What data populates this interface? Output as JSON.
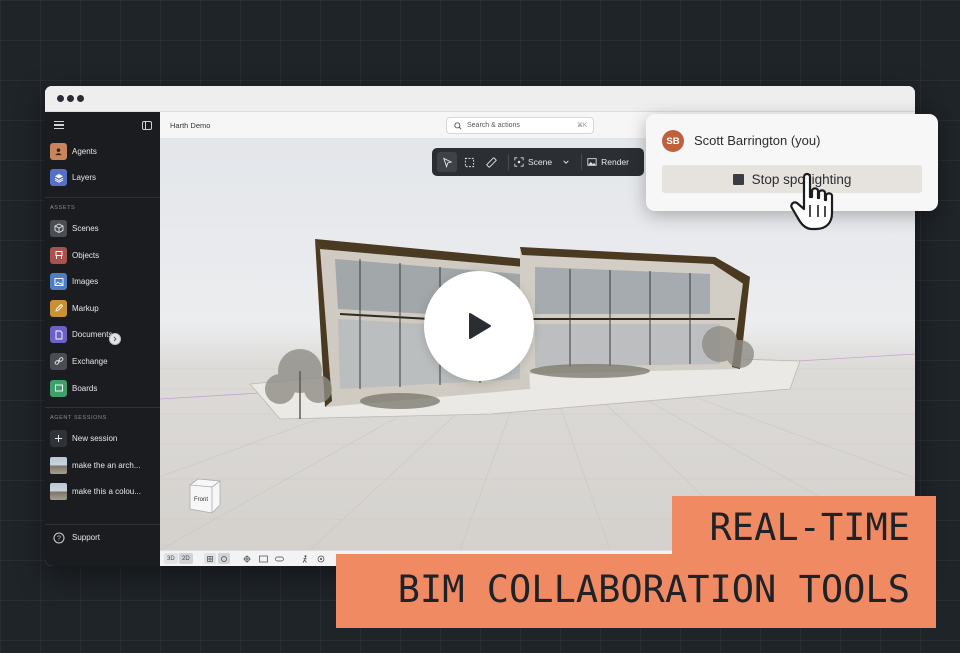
{
  "app": {
    "project_name": "Harth Demo",
    "search_placeholder": "Search & actions",
    "search_shortcut": "⌘K"
  },
  "sidebar": {
    "top_items": [
      {
        "label": "Agents",
        "icon": "agent-icon",
        "color": "#c9855a"
      },
      {
        "label": "Layers",
        "icon": "layers-icon",
        "color": "#5670c9"
      }
    ],
    "assets_heading": "ASSETS",
    "asset_items": [
      {
        "label": "Scenes",
        "icon": "cube-icon",
        "color": "#4a4d53"
      },
      {
        "label": "Objects",
        "icon": "chair-icon",
        "color": "#a8524c"
      },
      {
        "label": "Images",
        "icon": "image-icon",
        "color": "#4f7dc2"
      },
      {
        "label": "Markup",
        "icon": "pen-icon",
        "color": "#c99035"
      },
      {
        "label": "Documents",
        "icon": "document-icon",
        "color": "#6c61c4"
      },
      {
        "label": "Exchange",
        "icon": "link-icon",
        "color": "#4a4d53"
      },
      {
        "label": "Boards",
        "icon": "board-icon",
        "color": "#3f9e6a"
      }
    ],
    "sessions_heading": "AGENT SESSIONS",
    "session_items": [
      {
        "label": "New session",
        "icon": "plus-icon"
      },
      {
        "label": "make the an arch...",
        "icon": "thumbnail"
      },
      {
        "label": "make this a colou...",
        "icon": "thumbnail"
      }
    ],
    "support_label": "Support"
  },
  "toolbar": {
    "scene_label": "Scene",
    "render_label": "Render"
  },
  "bottombar": {
    "mode_3d": "3D",
    "mode_2d": "2D"
  },
  "viewcube": {
    "face_label": "Front"
  },
  "spotlight_popup": {
    "avatar_initials": "SB",
    "user_name": "Scott Barrington (you)",
    "stop_label": "Stop spotlighting"
  },
  "caption": {
    "line1": "REAL-TIME",
    "line2": "BIM COLLABORATION TOOLS",
    "background": "#f08a62"
  }
}
